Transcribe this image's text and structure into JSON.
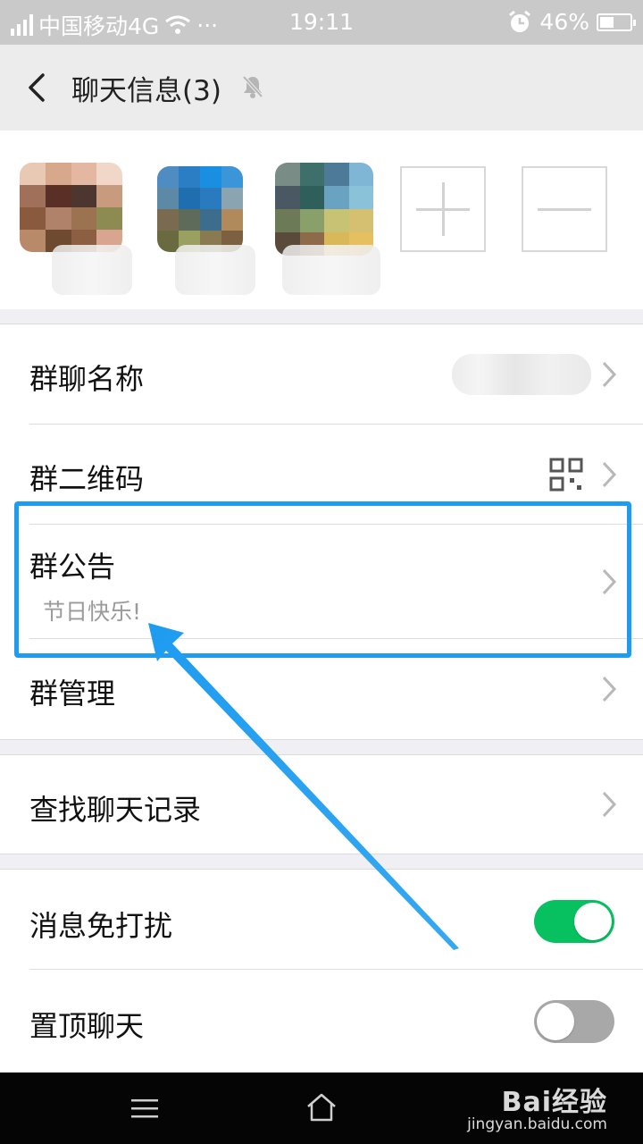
{
  "status_bar": {
    "carrier": "中国移动4G",
    "more": "···",
    "time": "19:11",
    "battery": "46%",
    "battery_level": 0.46
  },
  "header": {
    "title": "聊天信息(3)"
  },
  "members": {
    "add_icon": "plus-icon",
    "remove_icon": "minus-icon"
  },
  "groups": [
    {
      "rows": [
        {
          "label": "群聊名称"
        },
        {
          "label": "群二维码"
        },
        {
          "label": "群公告",
          "sub": "节日快乐!"
        },
        {
          "label": "群管理"
        }
      ]
    },
    {
      "rows": [
        {
          "label": "查找聊天记录"
        }
      ]
    },
    {
      "rows": [
        {
          "label": "消息免打扰",
          "toggle": true
        },
        {
          "label": "置顶聊天",
          "toggle": false
        }
      ]
    }
  ],
  "colors": {
    "toggle_on": "#07c160",
    "toggle_off": "#a8a8a8",
    "highlight": "#1e9cf0"
  },
  "watermark": {
    "brand": "Bai经验",
    "url": "jingyan.baidu.com"
  }
}
